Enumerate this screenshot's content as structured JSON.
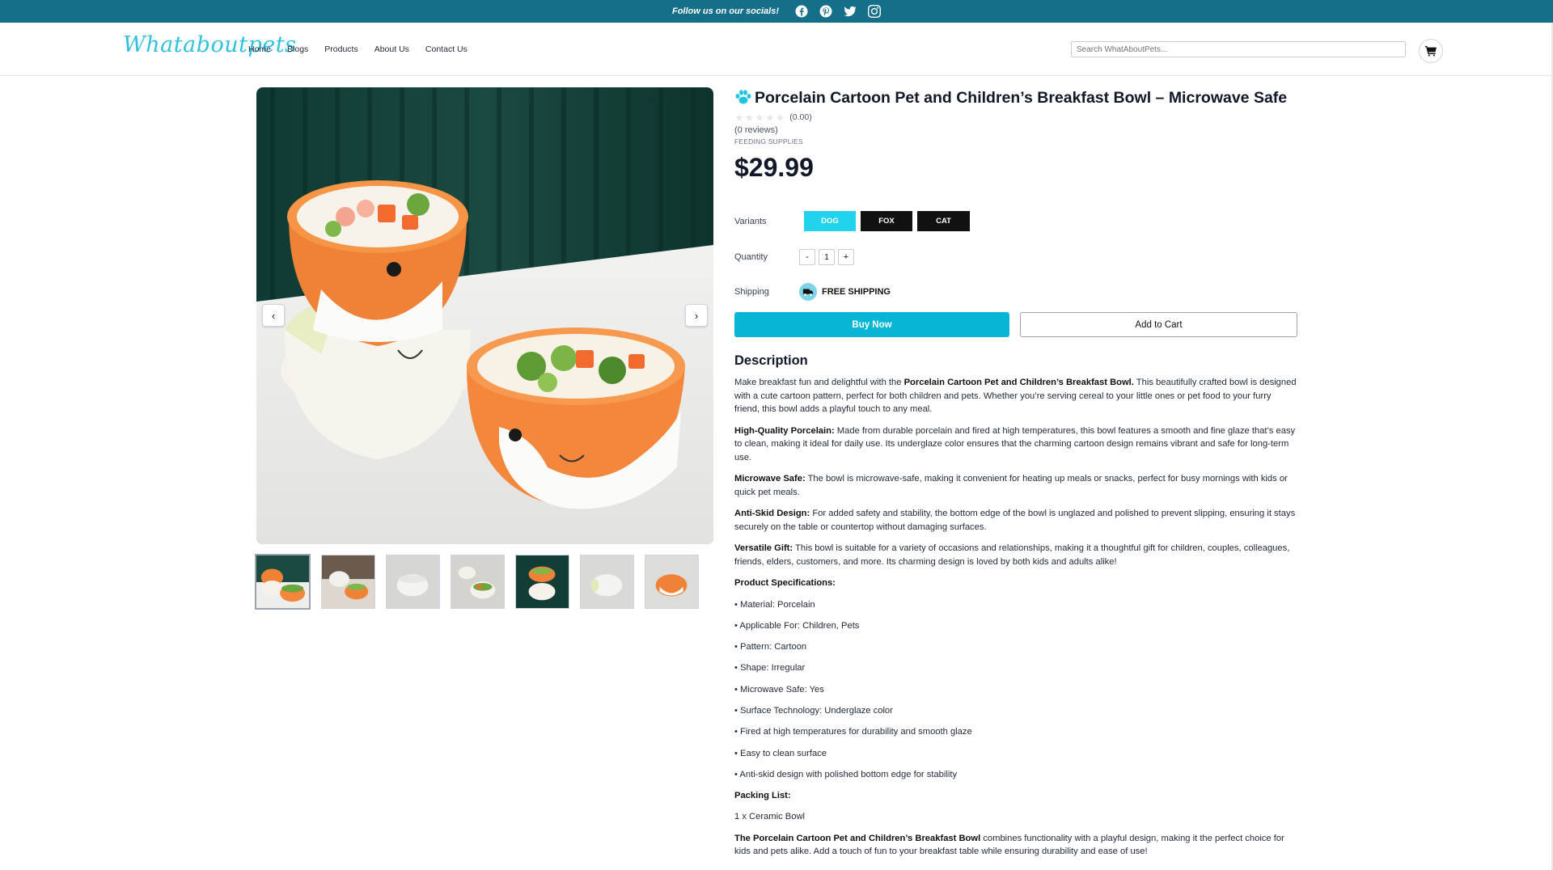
{
  "topbar": {
    "follow_text": "Follow us on our socials!",
    "icons": [
      "facebook-icon",
      "pinterest-icon",
      "twitter-icon",
      "instagram-icon"
    ]
  },
  "header": {
    "logo": "Whataboutpets",
    "nav": [
      "Home",
      "Blogs",
      "Products",
      "About Us",
      "Contact Us"
    ],
    "search_placeholder": "Search WhatAboutPets...",
    "cart_icon": "cart-icon"
  },
  "gallery": {
    "prev_label": "‹",
    "next_label": "›",
    "thumb_count": 7
  },
  "product": {
    "title": "Porcelain Cartoon Pet and Children’s Breakfast Bowl – Microwave Safe",
    "rating_value": "(0.00)",
    "rating_stars": 0,
    "reviews": "(0 reviews)",
    "category": "FEEDING SUPPLIES",
    "price": "$29.99",
    "variants_label": "Variants",
    "variants": [
      "DOG",
      "FOX",
      "CAT"
    ],
    "selected_variant": "DOG",
    "quantity_label": "Quantity",
    "qty_minus": "-",
    "qty_value": "1",
    "qty_plus": "+",
    "shipping_label": "Shipping",
    "shipping_value": "FREE SHIPPING",
    "buy_now": "Buy Now",
    "add_to_cart": "Add to Cart"
  },
  "description": {
    "heading": "Description",
    "intro_pre": "Make breakfast fun and delightful with the ",
    "intro_bold": "Porcelain Cartoon Pet and Children’s Breakfast Bowl.",
    "intro_post": " This beautifully crafted bowl is designed with a cute cartoon pattern, perfect for both children and pets. Whether you’re serving cereal to your little ones or pet food to your furry friend, this bowl adds a playful touch to any meal.",
    "features": [
      {
        "title": "High-Quality Porcelain:",
        "text": " Made from durable porcelain and fired at high temperatures, this bowl features a smooth and fine glaze that’s easy to clean, making it ideal for daily use. Its underglaze color ensures that the charming cartoon design remains vibrant and safe for long-term use."
      },
      {
        "title": "Microwave Safe:",
        "text": " The bowl is microwave-safe, making it convenient for heating up meals or snacks, perfect for busy mornings with kids or quick pet meals."
      },
      {
        "title": "Anti-Skid Design:",
        "text": " For added safety and stability, the bottom edge of the bowl is unglazed and polished to prevent slipping, ensuring it stays securely on the table or countertop without damaging surfaces."
      },
      {
        "title": "Versatile Gift:",
        "text": " This bowl is suitable for a variety of occasions and relationships, making it a thoughtful gift for children, couples, colleagues, friends, elders, customers, and more. Its charming design is loved by both kids and adults alike!"
      }
    ],
    "specs_heading": "Product Specifications:",
    "specs": [
      "• Material: Porcelain",
      "• Applicable For: Children, Pets",
      "• Pattern: Cartoon",
      "• Shape: Irregular",
      "• Microwave Safe: Yes",
      "• Surface Technology: Underglaze color",
      "• Fired at high temperatures for durability and smooth glaze",
      "• Easy to clean surface",
      "• Anti-skid design with polished bottom edge for stability"
    ],
    "packing_heading": "Packing List:",
    "packing_item": "1 x Ceramic Bowl",
    "closing_bold": "The Porcelain Cartoon Pet and Children’s Breakfast Bowl",
    "closing_text": " combines functionality with a playful design, making it the perfect choice for kids and pets alike. Add a touch of fun to your breakfast table while ensuring durability and ease of use!"
  },
  "colors": {
    "topbar": "#156f89",
    "accent": "#06b6d4",
    "variant_selected": "#22d3ee",
    "variant_default": "#111111"
  }
}
